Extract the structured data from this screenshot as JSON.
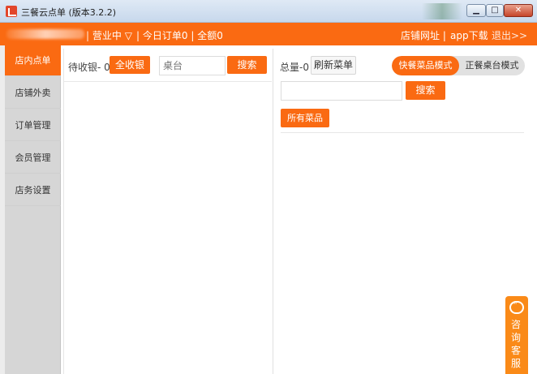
{
  "window": {
    "title": "三餐云点单 (版本3.2.2)",
    "minimize_glyph": "▁",
    "maximize_glyph": "□",
    "close_glyph": "✕"
  },
  "topbar": {
    "separator1": "|",
    "status": "营业中",
    "status_caret": "▽",
    "separator2": "|",
    "today_orders": "今日订单0",
    "separator3": "|",
    "total_amount": "全额0",
    "shop_url": "店铺网址",
    "separator4": "|",
    "app_download": "app下载",
    "logout": "退出>>"
  },
  "sidebar": {
    "items": [
      {
        "label": "店内点单",
        "active": true
      },
      {
        "label": "店铺外卖",
        "active": false
      },
      {
        "label": "订单管理",
        "active": false
      },
      {
        "label": "会员管理",
        "active": false
      },
      {
        "label": "店务设置",
        "active": false
      }
    ]
  },
  "middle": {
    "pending_label": "待收银- 0",
    "checkout_all": "全收银",
    "table_placeholder": "桌台",
    "search": "搜索"
  },
  "right": {
    "total_label": "总量-0",
    "refresh_menu": "刷新菜单",
    "mode_fast": "快餐菜品模式",
    "mode_table": "正餐桌台模式",
    "dish_search_value": "",
    "search": "搜索",
    "all_dishes": "所有菜品"
  },
  "customer_service": {
    "icon": "chat-bubble-icon",
    "label": "咨询客服"
  },
  "colors": {
    "accent": "#fa6a12",
    "sidebar_bg": "#d6d6d6"
  }
}
